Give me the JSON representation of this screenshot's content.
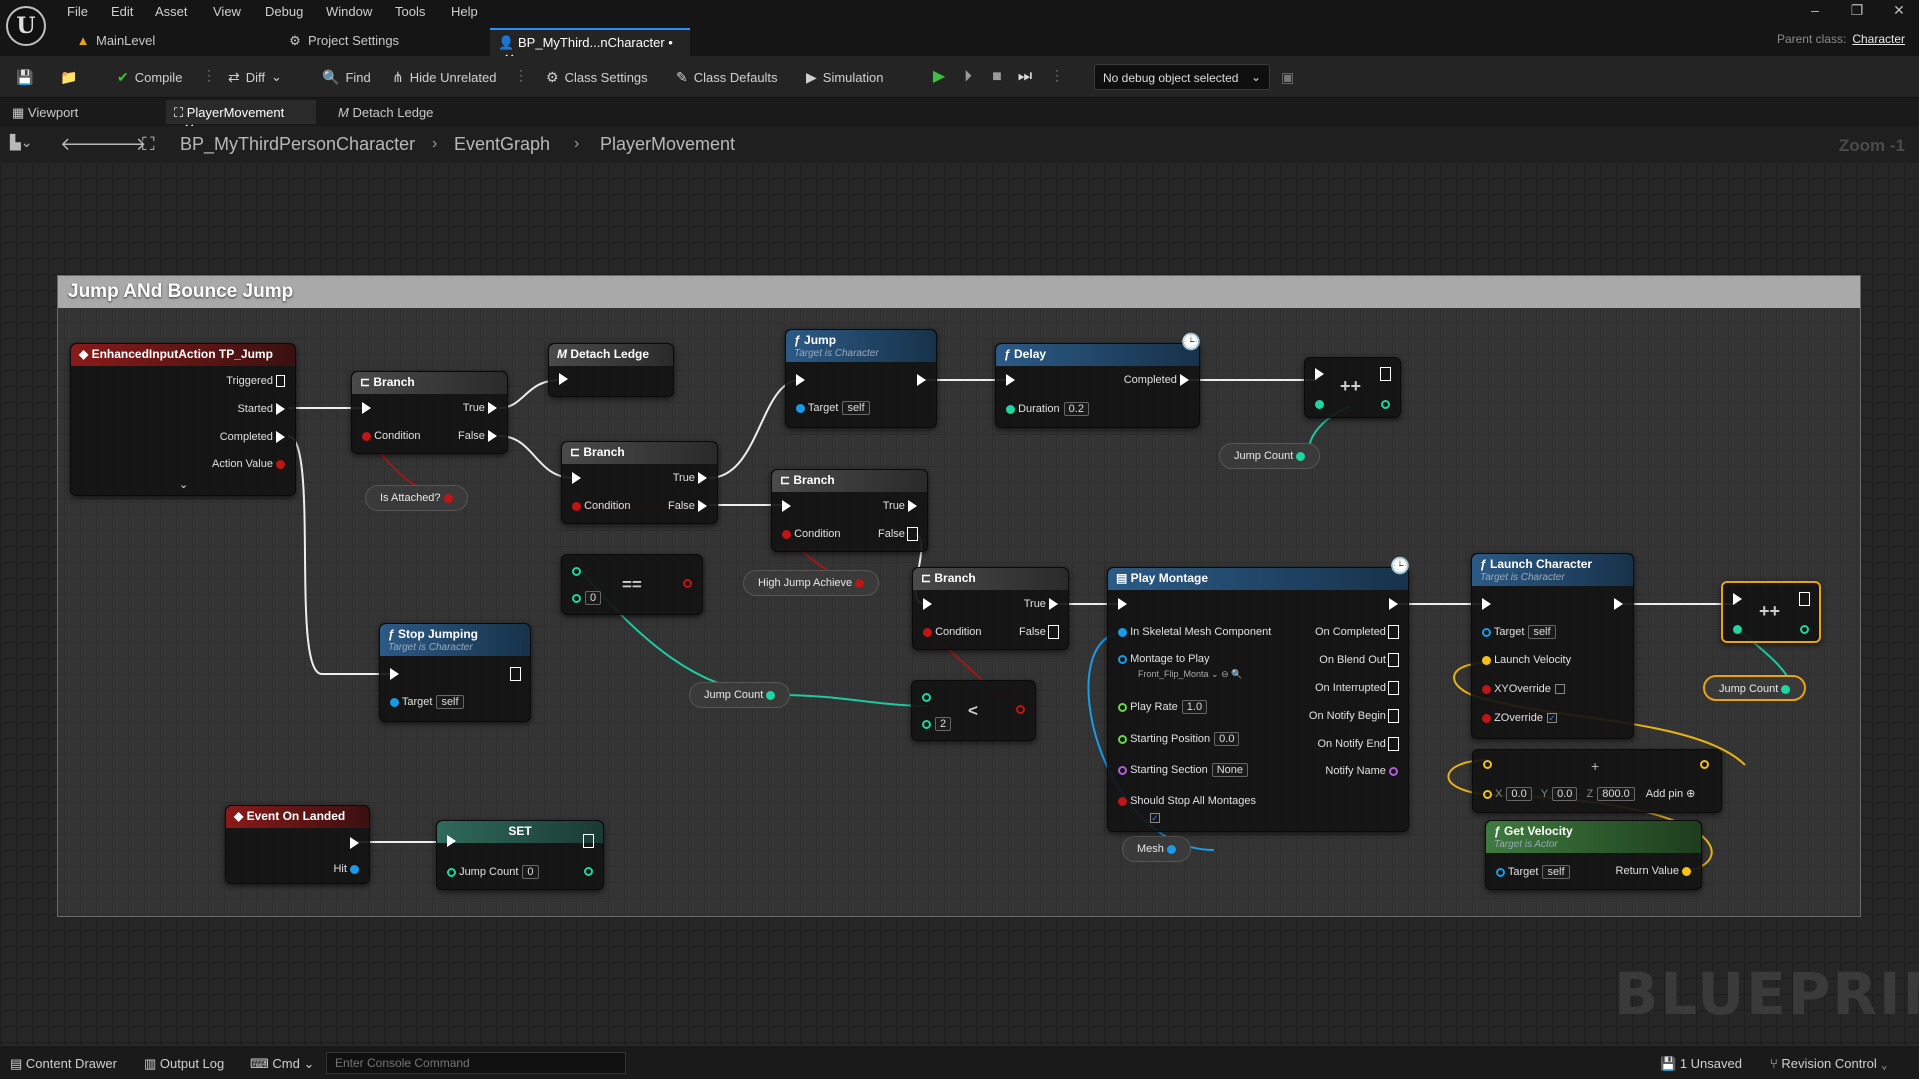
{
  "menu": {
    "items": [
      "File",
      "Edit",
      "Asset",
      "View",
      "Debug",
      "Window",
      "Tools",
      "Help"
    ]
  },
  "logo": {
    "glyph": "U"
  },
  "window_controls": {
    "minimize": "–",
    "restore": "❐",
    "close": "✕"
  },
  "doc_tabs": [
    {
      "label": "MainLevel",
      "icon": "level-icon"
    },
    {
      "label": "Project Settings",
      "icon": "gear-icon"
    },
    {
      "label": "BP_MyThird...nCharacter •",
      "icon": "character-icon",
      "active": true
    }
  ],
  "parent_class": {
    "label": "Parent class:",
    "value": "Character"
  },
  "toolbar": {
    "compile": "Compile",
    "diff": "Diff",
    "find": "Find",
    "hide_unrelated": "Hide Unrelated",
    "class_settings": "Class Settings",
    "class_defaults": "Class Defaults",
    "simulation": "Simulation",
    "debug_object": "No debug object selected"
  },
  "panel_tabs": {
    "viewport": "Viewport",
    "player_movement": "PlayerMovement",
    "detach_ledge": "Detach Ledge"
  },
  "breadcrumb": [
    "BP_MyThirdPersonCharacter",
    "EventGraph",
    "PlayerMovement"
  ],
  "zoom": "Zoom -1",
  "graph": {
    "comment_title": "Jump ANd Bounce Jump",
    "nodes": {
      "input_action": {
        "title": "EnhancedInputAction TP_Jump",
        "pins": [
          "Triggered",
          "Started",
          "Completed",
          "Action Value"
        ]
      },
      "branch1": {
        "title": "Branch",
        "condition": "Condition",
        "true": "True",
        "false": "False"
      },
      "detach_ledge": {
        "title": "Detach Ledge"
      },
      "branch2": {
        "title": "Branch",
        "condition": "Condition",
        "true": "True",
        "false": "False"
      },
      "jump": {
        "title": "Jump",
        "subtitle": "Target is Character",
        "target": "Target",
        "target_value": "self"
      },
      "delay": {
        "title": "Delay",
        "completed": "Completed",
        "duration": "Duration",
        "duration_value": "0.2"
      },
      "branch3": {
        "title": "Branch",
        "condition": "Condition",
        "true": "True",
        "false": "False"
      },
      "branch4": {
        "title": "Branch",
        "condition": "Condition",
        "true": "True",
        "false": "False"
      },
      "is_attached": "Is Attached?",
      "high_jump": "High Jump Achieve",
      "jump_count_a": "Jump Count",
      "jump_count_b": "Jump Count",
      "jump_count_c": "Jump Count",
      "equals": {
        "op": "==",
        "value": "0"
      },
      "less": {
        "op": "<",
        "value": "2"
      },
      "increment_a": "++",
      "increment_b": "++",
      "stop_jumping": {
        "title": "Stop Jumping",
        "subtitle": "Target is Character",
        "target": "Target",
        "target_value": "self"
      },
      "event_landed": {
        "title": "Event On Landed",
        "hit": "Hit"
      },
      "set": {
        "title": "SET",
        "var": "Jump Count",
        "value": "0"
      },
      "play_montage": {
        "title": "Play Montage",
        "inputs": [
          "In Skeletal Mesh Component",
          "Montage to Play",
          "Play Rate",
          "Starting Position",
          "Starting Section",
          "Should Stop All Montages"
        ],
        "montage_value": "Front_Flip_Monta",
        "play_rate": "1.0",
        "starting_position": "0.0",
        "starting_section": "None",
        "outputs": [
          "On Completed",
          "On Blend Out",
          "On Interrupted",
          "On Notify Begin",
          "On Notify End",
          "Notify Name"
        ]
      },
      "mesh": "Mesh",
      "launch_character": {
        "title": "Launch Character",
        "subtitle": "Target is Character",
        "target": "Target",
        "target_value": "self",
        "launch_velocity": "Launch Velocity",
        "xy_override": "XYOverride",
        "z_override": "ZOverride"
      },
      "make_vector": {
        "x_label": "X",
        "x": "0.0",
        "y_label": "Y",
        "y": "0.0",
        "z_label": "Z",
        "z": "800.0",
        "add_pin": "Add pin"
      },
      "get_velocity": {
        "title": "Get Velocity",
        "subtitle": "Target is Actor",
        "target": "Target",
        "target_value": "self",
        "return_value": "Return Value"
      }
    }
  },
  "watermark": "BLUEPRINT",
  "bottombar": {
    "content_drawer": "Content Drawer",
    "output_log": "Output Log",
    "cmd": "Cmd",
    "console_placeholder": "Enter Console Command",
    "unsaved": "1 Unsaved",
    "revision_control": "Revision Control"
  }
}
